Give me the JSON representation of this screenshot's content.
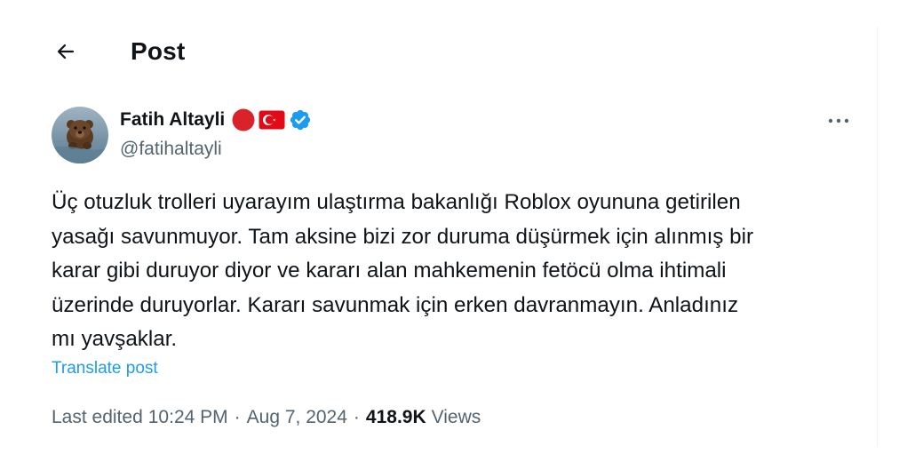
{
  "header": {
    "back_icon": "arrow-left-icon",
    "title": "Post"
  },
  "author": {
    "display_name": "Fatih Altayli",
    "handle": "@fatihaltayli",
    "avatar": "bear-in-water-avatar",
    "badges": [
      "red-circle-icon",
      "turkey-flag-icon",
      "verified-badge-icon"
    ]
  },
  "post": {
    "text": "Üç otuzluk trolleri uyarayım ulaştırma bakanlığı Roblox oyununa getirilen\nyasağı savunmuyor. Tam aksine bizi zor duruma düşürmek için alınmış bir\nkarar gibi duruyor diyor ve kararı alan mahkemenin fetöcü olma ihtimali\nüzerinde duruyorlar.  Kararı savunmak için erken davranmayın. Anladınız\nmı yavşaklar.",
    "translate_label": "Translate post"
  },
  "meta": {
    "edited_prefix": "Last edited",
    "time": "10:24 PM",
    "separator": "·",
    "date": "Aug 7, 2024",
    "views_count": "418.9K",
    "views_label": "Views"
  },
  "colors": {
    "accent": "#1d9bf0",
    "text_primary": "#0f1419",
    "text_secondary": "#536471",
    "red_dot": "#d8232a",
    "flag_red": "#e30a17"
  }
}
